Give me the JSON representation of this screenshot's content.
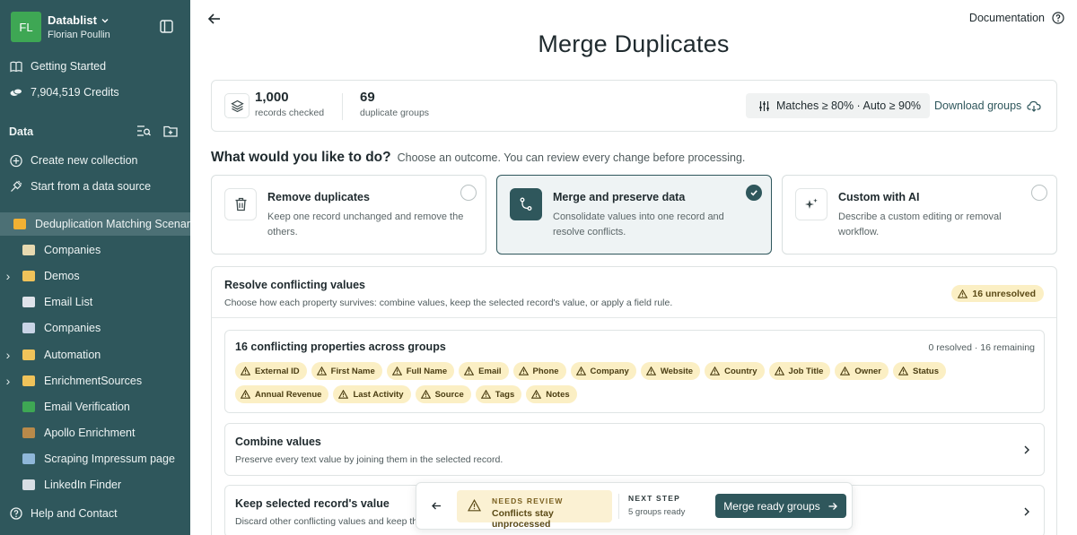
{
  "sidebar": {
    "workspace": {
      "initials": "FL",
      "name": "Datablist",
      "user": "Florian Poullin"
    },
    "getting_started": "Getting Started",
    "credits": "7,904,519 Credits",
    "section_title": "Data",
    "create_collection": "Create new collection",
    "start_from_source": "Start from a data source",
    "items": [
      {
        "label": "Deduplication Matching Scenar",
        "active": true,
        "expandable": false,
        "color": "#f2b133"
      },
      {
        "label": "Companies",
        "active": false,
        "expandable": false,
        "color": "#e7d9b0"
      },
      {
        "label": "Demos",
        "active": false,
        "expandable": true,
        "color": "#f0c35a"
      },
      {
        "label": "Email List",
        "active": false,
        "expandable": false,
        "color": "#dfe3ea"
      },
      {
        "label": "Companies",
        "active": false,
        "expandable": false,
        "color": "#c9d4e6"
      },
      {
        "label": "Automation",
        "active": false,
        "expandable": true,
        "color": "#f0c35a"
      },
      {
        "label": "EnrichmentSources",
        "active": false,
        "expandable": true,
        "color": "#f0c35a"
      },
      {
        "label": "Email Verification",
        "active": false,
        "expandable": false,
        "color": "#3ea754"
      },
      {
        "label": "Apollo Enrichment",
        "active": false,
        "expandable": false,
        "color": "#b98a4a"
      },
      {
        "label": "Scraping Impressum page",
        "active": false,
        "expandable": false,
        "color": "#8fb7d9"
      },
      {
        "label": "LinkedIn Finder",
        "active": false,
        "expandable": false,
        "color": "#d7dde3"
      }
    ],
    "help": "Help and Contact"
  },
  "header": {
    "documentation": "Documentation",
    "title": "Merge Duplicates"
  },
  "stats": {
    "records": {
      "value": "1,000",
      "label": "records checked"
    },
    "groups": {
      "value": "69",
      "label": "duplicate groups"
    },
    "thresholds": "Matches ≥ 80% · Auto ≥ 90%",
    "download": "Download groups"
  },
  "question": {
    "title": "What would you like to do?",
    "subtitle": "Choose an outcome. You can review every change before processing."
  },
  "options": [
    {
      "title": "Remove duplicates",
      "desc": "Keep one record unchanged and remove the others.",
      "selected": false
    },
    {
      "title": "Merge and preserve data",
      "desc": "Consolidate values into one record and resolve conflicts.",
      "selected": true
    },
    {
      "title": "Custom with AI",
      "desc": "Describe a custom editing or removal workflow.",
      "selected": false
    }
  ],
  "resolve": {
    "title": "Resolve conflicting values",
    "subtitle": "Choose how each property survives: combine values, keep the selected record's value, or apply a field rule.",
    "unresolved": "16 unresolved",
    "props_title": "16 conflicting properties across groups",
    "props_count": "0 resolved · 16 remaining",
    "chips": [
      "External ID",
      "First Name",
      "Full Name",
      "Email",
      "Phone",
      "Company",
      "Website",
      "Country",
      "Job Title",
      "Owner",
      "Status",
      "Annual Revenue",
      "Last Activity",
      "Source",
      "Tags",
      "Notes"
    ],
    "combine": {
      "title": "Combine values",
      "desc": "Preserve every text value by joining them in the selected record."
    },
    "keep": {
      "title": "Keep selected record's value",
      "desc": "Discard other conflicting values and keep the"
    }
  },
  "floatbar": {
    "needs_review": "NEEDS REVIEW",
    "conflicts": "Conflicts stay unprocessed",
    "next_step": "NEXT STEP",
    "groups_ready": "5 groups ready",
    "button": "Merge ready groups"
  },
  "colors": {
    "brand": "#2f575c",
    "warning_bg": "#fbefc4",
    "avatar": "#3ea754"
  }
}
